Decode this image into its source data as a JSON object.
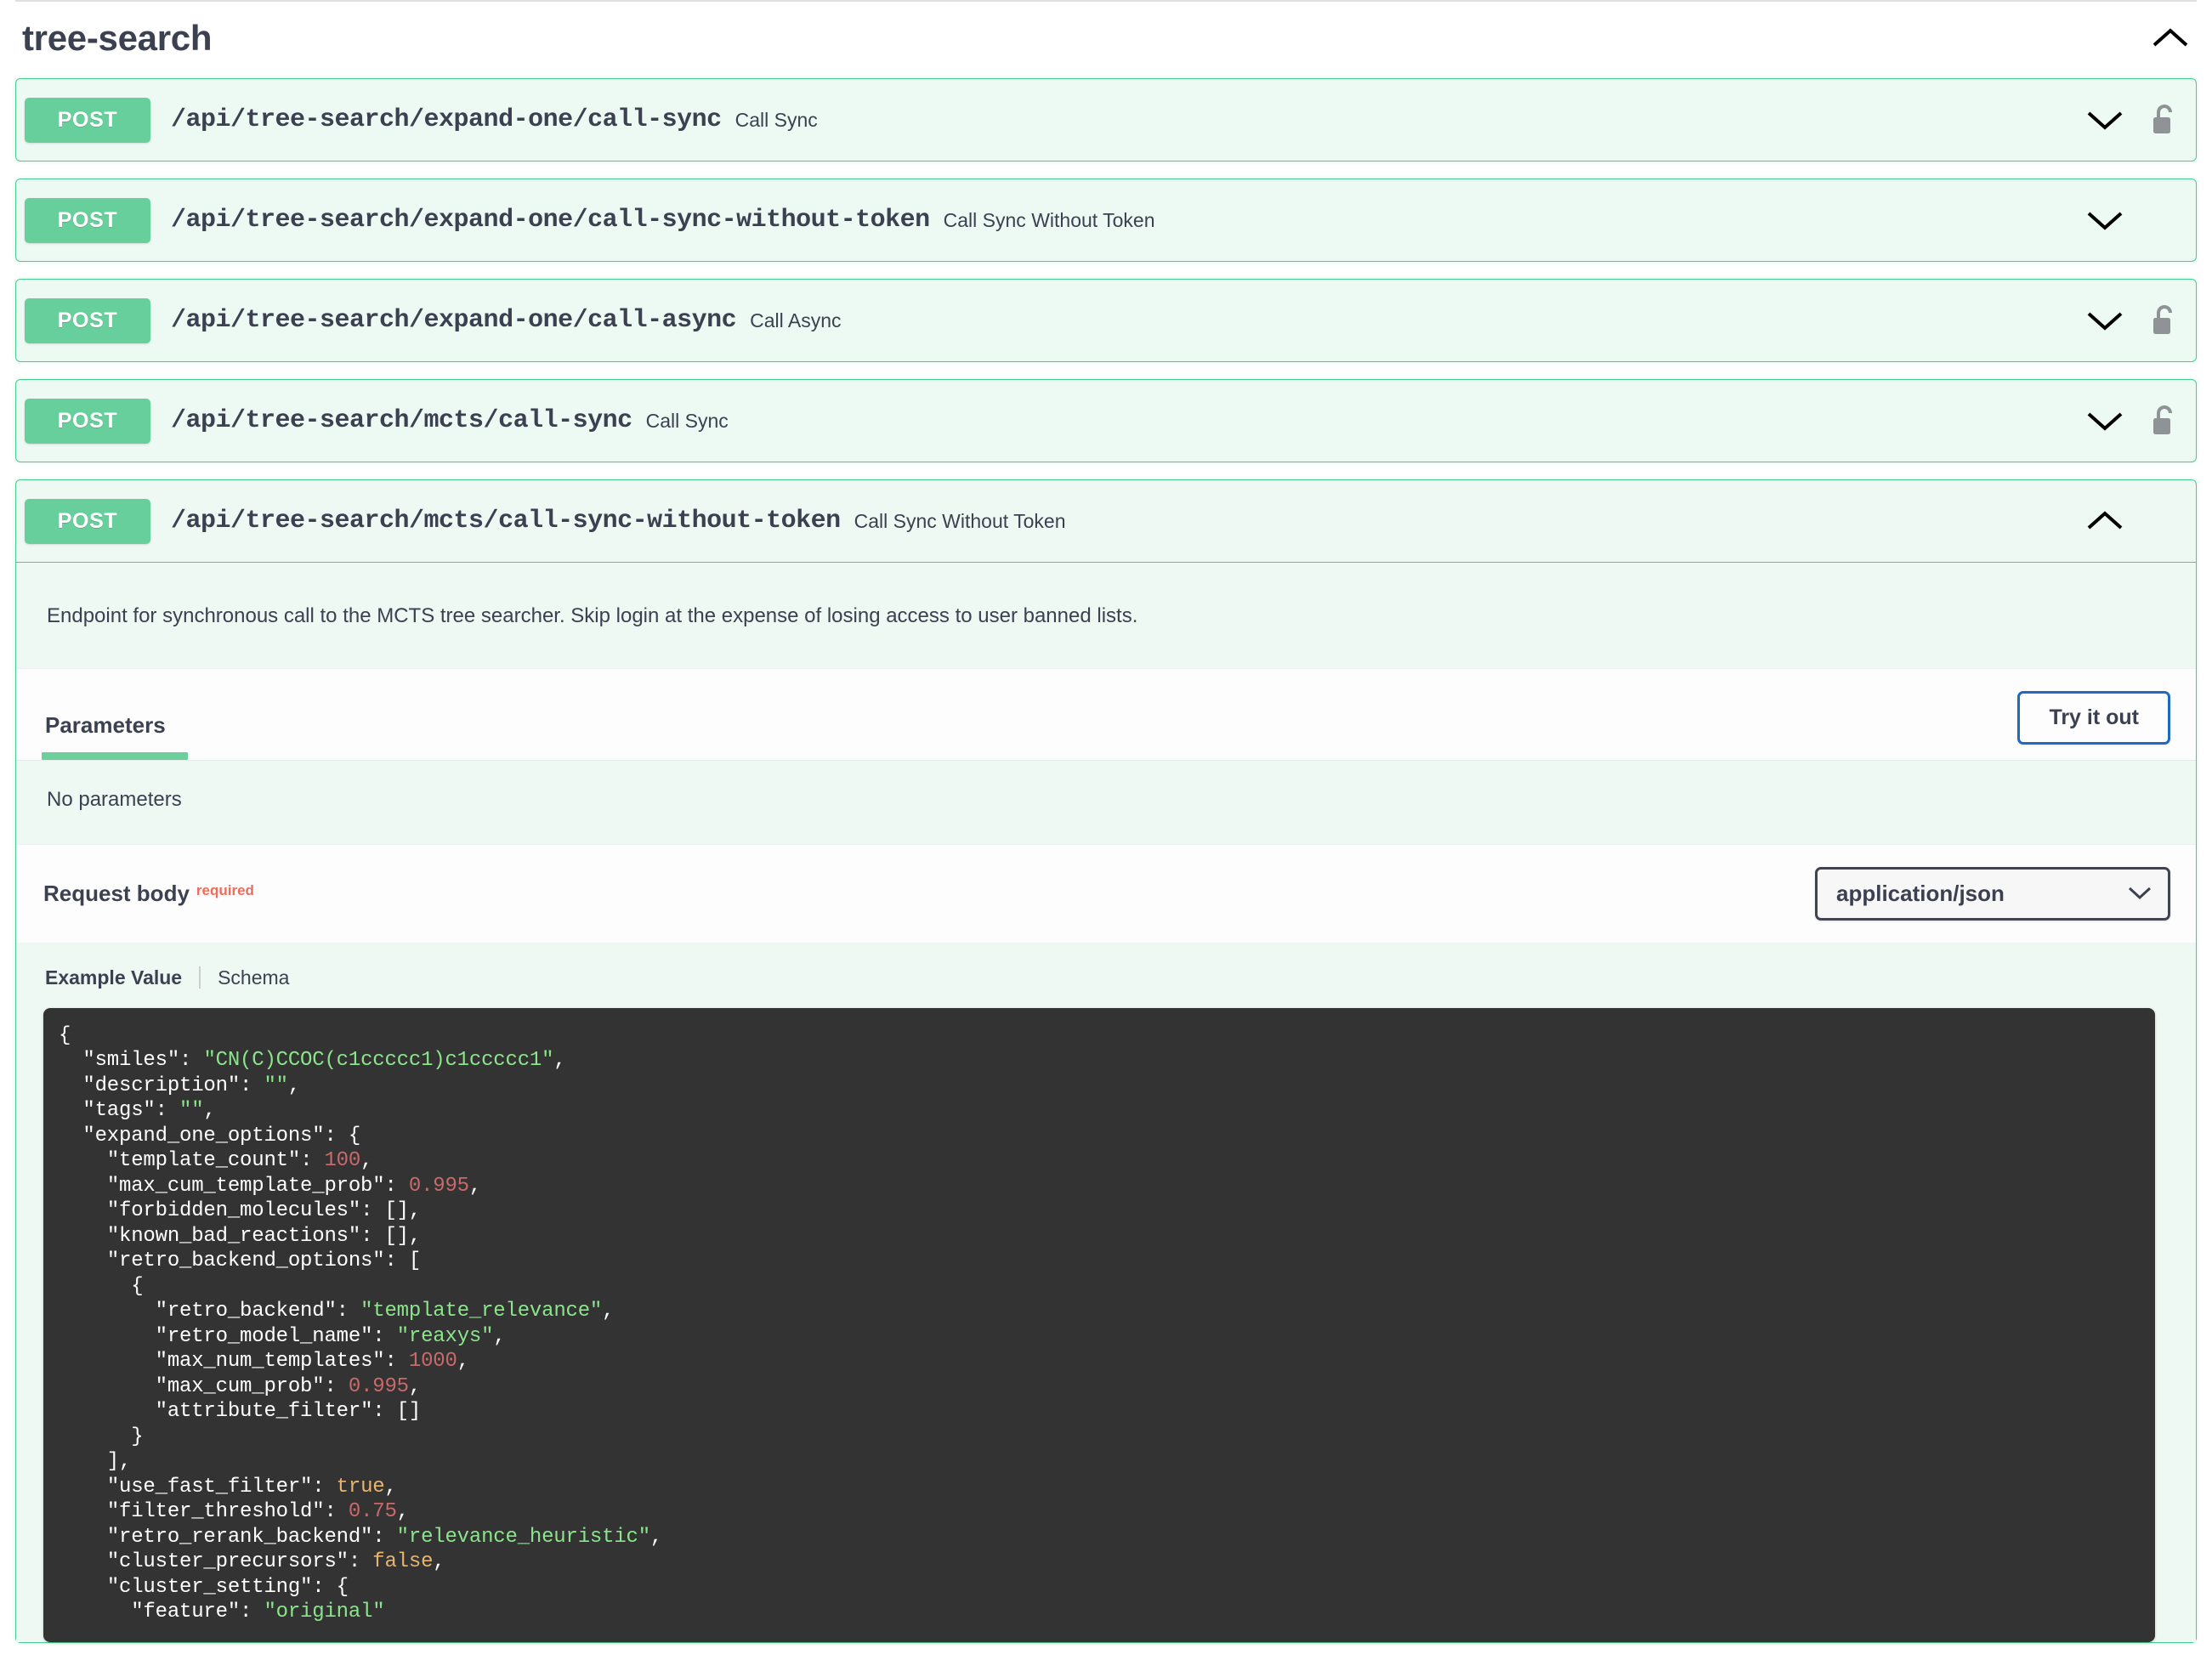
{
  "tag": {
    "title": "tree-search",
    "collapse_icon": "chevron-up-icon"
  },
  "operations": [
    {
      "method": "POST",
      "path": "/api/tree-search/expand-one/call-sync",
      "summary": "Call Sync",
      "expanded": false,
      "has_lock": true,
      "arrow_icon": "chevron-down-icon",
      "lock_icon": "unlocked-padlock-icon"
    },
    {
      "method": "POST",
      "path": "/api/tree-search/expand-one/call-sync-without-token",
      "summary": "Call Sync Without Token",
      "expanded": false,
      "has_lock": false,
      "arrow_icon": "chevron-down-icon",
      "lock_icon": ""
    },
    {
      "method": "POST",
      "path": "/api/tree-search/expand-one/call-async",
      "summary": "Call Async",
      "expanded": false,
      "has_lock": true,
      "arrow_icon": "chevron-down-icon",
      "lock_icon": "unlocked-padlock-icon"
    },
    {
      "method": "POST",
      "path": "/api/tree-search/mcts/call-sync",
      "summary": "Call Sync",
      "expanded": false,
      "has_lock": true,
      "arrow_icon": "chevron-down-icon",
      "lock_icon": "unlocked-padlock-icon"
    },
    {
      "method": "POST",
      "path": "/api/tree-search/mcts/call-sync-without-token",
      "summary": "Call Sync Without Token",
      "expanded": true,
      "has_lock": false,
      "arrow_icon": "chevron-up-icon",
      "lock_icon": ""
    }
  ],
  "expanded_operation": {
    "description": "Endpoint for synchronous call to the MCTS tree searcher. Skip login at the expense of losing access to user banned lists.",
    "parameters_tab_label": "Parameters",
    "try_it_out_label": "Try it out",
    "no_parameters_text": "No parameters",
    "request_body_label": "Request body",
    "request_body_required_label": "required",
    "content_type_value": "application/json",
    "content_type_icon": "chevron-down-icon",
    "example_value_tab": "Example Value",
    "schema_tab": "Schema",
    "example_code": "{\n  \"smiles\": \"CN(C)CCOC(c1ccccc1)c1ccccc1\",\n  \"description\": \"\",\n  \"tags\": \"\",\n  \"expand_one_options\": {\n    \"template_count\": 100,\n    \"max_cum_template_prob\": 0.995,\n    \"forbidden_molecules\": [],\n    \"known_bad_reactions\": [],\n    \"retro_backend_options\": [\n      {\n        \"retro_backend\": \"template_relevance\",\n        \"retro_model_name\": \"reaxys\",\n        \"max_num_templates\": 1000,\n        \"max_cum_prob\": 0.995,\n        \"attribute_filter\": []\n      }\n    ],\n    \"use_fast_filter\": true,\n    \"filter_threshold\": 0.75,\n    \"retro_rerank_backend\": \"relevance_heuristic\",\n    \"cluster_precursors\": false,\n    \"cluster_setting\": {\n      \"feature\": \"original\""
  },
  "colors": {
    "post_green": "#49cc90",
    "post_badge": "#66cf9b",
    "block_bg": "#ecfaf3",
    "text": "#3b4151",
    "required_red": "#f06b5a",
    "try_it_out_border": "#1f69c0",
    "code_bg": "#333333",
    "code_string": "#8ae68a",
    "code_number": "#c96a6a",
    "code_bool": "#e8b470"
  }
}
